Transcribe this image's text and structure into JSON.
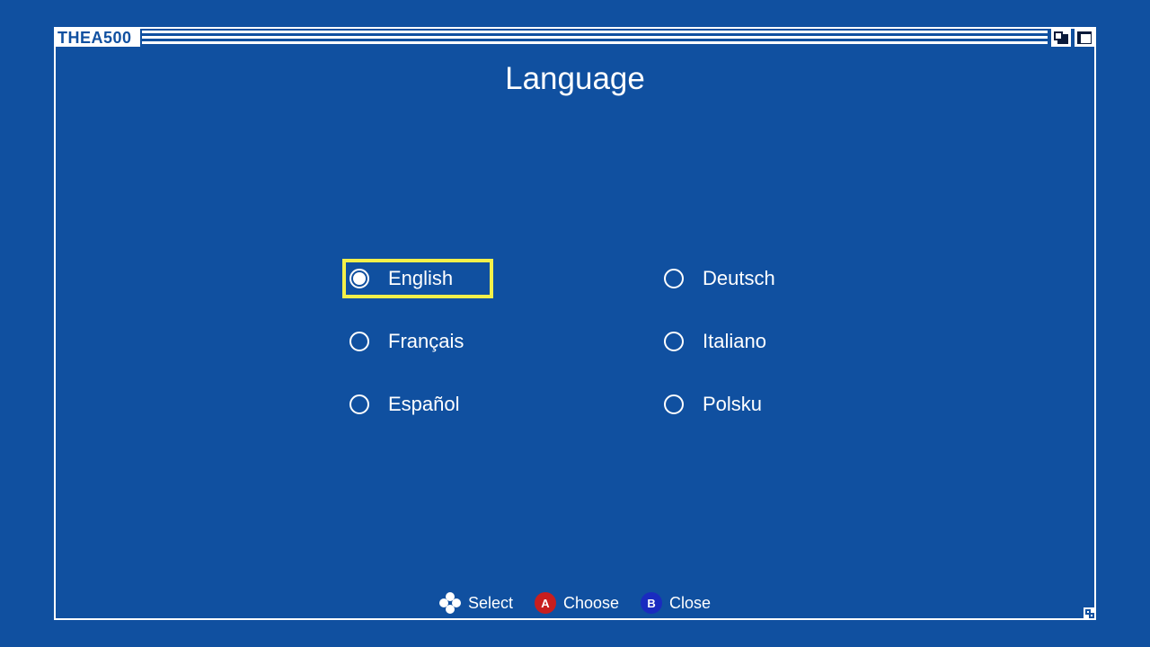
{
  "window": {
    "brand": "THEA500"
  },
  "page": {
    "title": "Language"
  },
  "languages": [
    {
      "label": "English",
      "selected": true
    },
    {
      "label": "Deutsch",
      "selected": false
    },
    {
      "label": "Français",
      "selected": false
    },
    {
      "label": "Italiano",
      "selected": false
    },
    {
      "label": "Español",
      "selected": false
    },
    {
      "label": "Polsku",
      "selected": false
    }
  ],
  "footer": {
    "select_label": "Select",
    "choose_button": "A",
    "choose_label": "Choose",
    "close_button": "B",
    "close_label": "Close"
  },
  "colors": {
    "background": "#1050a0",
    "focus_outline": "#f3f04a",
    "a_button": "#c81e1e",
    "b_button": "#1a2bbf"
  }
}
